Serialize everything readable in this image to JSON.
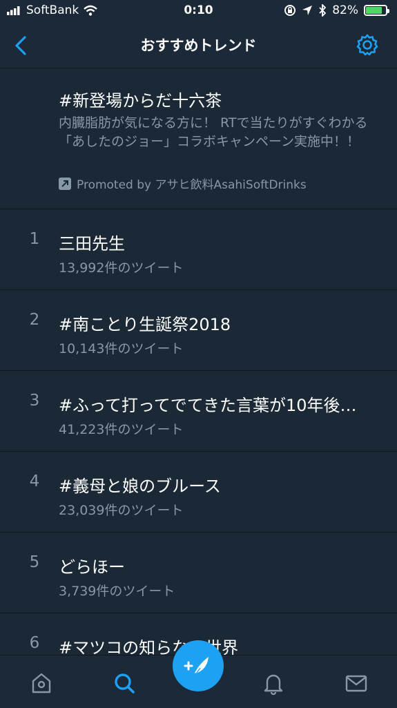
{
  "status": {
    "carrier": "SoftBank",
    "time": "0:10",
    "battery": "82%",
    "battery_level": 0.82
  },
  "nav": {
    "title": "おすすめトレンド",
    "back_icon": "chevron-left-icon",
    "settings_icon": "gear-icon"
  },
  "promoted": {
    "title": "#新登場からだ十六茶",
    "description": "内臓脂肪が気になる方に！ RTで当たりがすぐわかる「あしたのジョー」コラボキャンペーン実施中！！",
    "promoted_by": "Promoted by アサヒ飲料AsahiSoftDrinks"
  },
  "trends": [
    {
      "rank": "1",
      "title": "三田先生",
      "count": "13,992件のツイート"
    },
    {
      "rank": "2",
      "title": "#南ことり生誕祭2018",
      "count": "10,143件のツイート"
    },
    {
      "rank": "3",
      "title": "#ふって打ってでてきた言葉が10年後…",
      "count": "41,223件のツイート"
    },
    {
      "rank": "4",
      "title": "#義母と娘のブルース",
      "count": "23,039件のツイート"
    },
    {
      "rank": "5",
      "title": "どらほー",
      "count": "3,739件のツイート"
    },
    {
      "rank": "6",
      "title": "#マツコの知らない世界",
      "count": ""
    }
  ],
  "colors": {
    "accent": "#1da1f2",
    "background": "#1b2836",
    "secondary_text": "#8899a6",
    "battery": "#4cd964"
  }
}
